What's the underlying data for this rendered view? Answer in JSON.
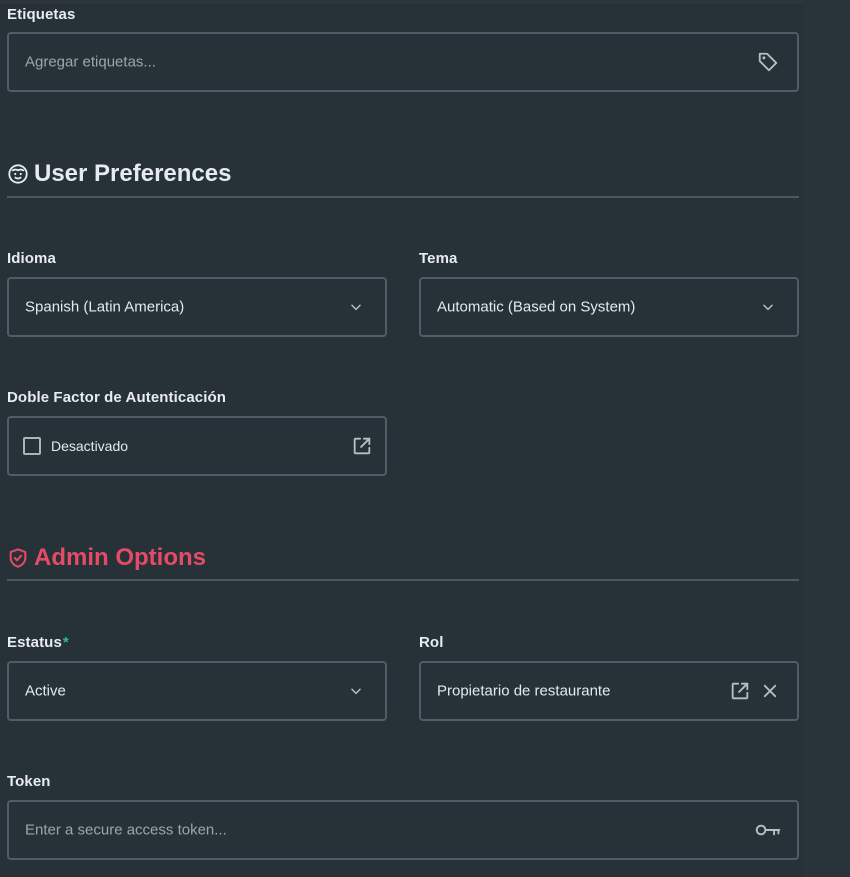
{
  "tags": {
    "label": "Etiquetas",
    "placeholder": "Agregar etiquetas...",
    "icon": "tag-icon"
  },
  "user_preferences": {
    "title": "User Preferences",
    "icon": "smiley-face-icon",
    "language": {
      "label": "Idioma",
      "value": "Spanish (Latin America)"
    },
    "theme": {
      "label": "Tema",
      "value": "Automatic (Based on System)"
    },
    "two_factor": {
      "label": "Doble Factor de Autenticación",
      "value": "Desactivado",
      "checked": false
    }
  },
  "admin_options": {
    "title": "Admin Options",
    "icon": "shield-check-icon",
    "accent_color": "#e54b66",
    "status": {
      "label": "Estatus",
      "required_mark": "*",
      "value": "Active"
    },
    "role": {
      "label": "Rol",
      "value": "Propietario de restaurante"
    },
    "token": {
      "label": "Token",
      "placeholder": "Enter a secure access token...",
      "icon": "key-icon"
    }
  },
  "colors": {
    "background": "#263238",
    "border": "#4f5e66",
    "required": "#23c483"
  }
}
